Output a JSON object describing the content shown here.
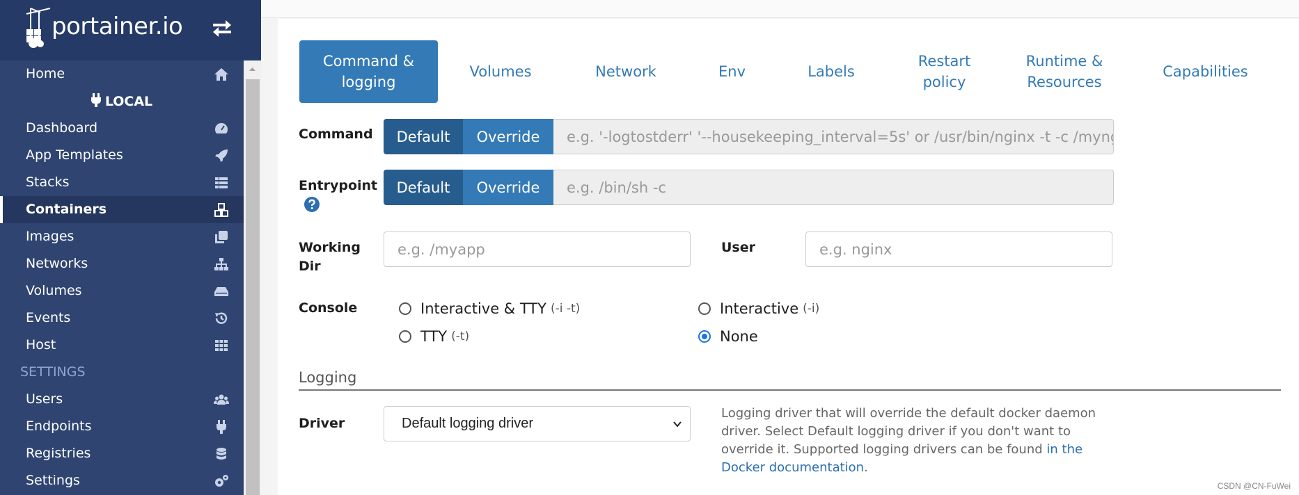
{
  "brand": {
    "name": "portainer.io"
  },
  "sidebar": {
    "items": [
      {
        "label": "Home",
        "icon": "home-icon"
      },
      {
        "label": "LOCAL",
        "icon": "plug-icon"
      },
      {
        "label": "Dashboard",
        "icon": "tachometer-icon"
      },
      {
        "label": "App Templates",
        "icon": "rocket-icon"
      },
      {
        "label": "Stacks",
        "icon": "th-list-icon"
      },
      {
        "label": "Containers",
        "icon": "cubes-icon",
        "active": true
      },
      {
        "label": "Images",
        "icon": "clone-icon"
      },
      {
        "label": "Networks",
        "icon": "sitemap-icon"
      },
      {
        "label": "Volumes",
        "icon": "hdd-icon"
      },
      {
        "label": "Events",
        "icon": "history-icon"
      },
      {
        "label": "Host",
        "icon": "th-icon"
      }
    ],
    "settings_heading": "SETTINGS",
    "settings_items": [
      {
        "label": "Users",
        "icon": "users-icon"
      },
      {
        "label": "Endpoints",
        "icon": "plug-icon"
      },
      {
        "label": "Registries",
        "icon": "database-icon"
      },
      {
        "label": "Settings",
        "icon": "cogs-icon"
      }
    ]
  },
  "tabs": [
    {
      "label": "Command & logging",
      "active": true
    },
    {
      "label": "Volumes"
    },
    {
      "label": "Network"
    },
    {
      "label": "Env"
    },
    {
      "label": "Labels"
    },
    {
      "label": "Restart policy"
    },
    {
      "label": "Runtime & Resources"
    },
    {
      "label": "Capabilities"
    }
  ],
  "form": {
    "command": {
      "label": "Command",
      "default_label": "Default",
      "override_label": "Override",
      "placeholder": "e.g. '-logtostderr' '--housekeeping_interval=5s' or /usr/bin/nginx -t -c /mynginx.conf"
    },
    "entrypoint": {
      "label": "Entrypoint",
      "default_label": "Default",
      "override_label": "Override",
      "placeholder": "e.g. /bin/sh -c"
    },
    "working_dir": {
      "label": "Working Dir",
      "placeholder": "e.g. /myapp"
    },
    "user": {
      "label": "User",
      "placeholder": "e.g. nginx"
    },
    "console": {
      "label": "Console",
      "options": [
        {
          "label": "Interactive & TTY",
          "hint": "(-i -t)",
          "checked": false
        },
        {
          "label": "Interactive",
          "hint": "(-i)",
          "checked": false
        },
        {
          "label": "TTY",
          "hint": "(-t)",
          "checked": false
        },
        {
          "label": "None",
          "hint": "",
          "checked": true
        }
      ]
    }
  },
  "logging": {
    "title": "Logging",
    "driver_label": "Driver",
    "driver_selected": "Default logging driver",
    "help_text": "Logging driver that will override the default docker daemon driver. Select Default logging driver if you don't want to override it. Supported logging drivers can be found ",
    "help_link": "in the Docker documentation",
    "help_end": "."
  },
  "watermark": "CSDN @CN-FuWei",
  "colors": {
    "sidebar": "#2f4470",
    "brand_bar": "#253a66",
    "primary": "#337ab7",
    "primary_dark": "#275d8e"
  }
}
